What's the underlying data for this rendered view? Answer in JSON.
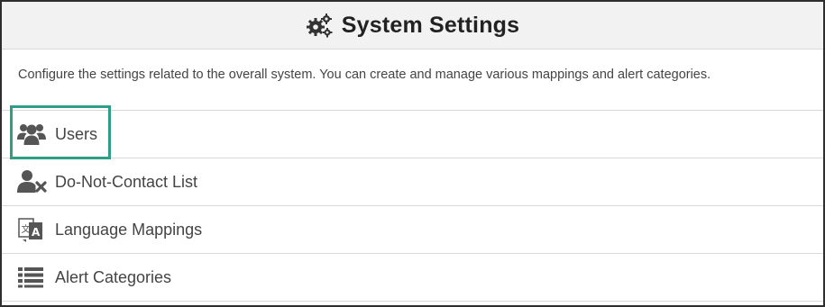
{
  "header": {
    "title": "System Settings",
    "icon": "gears-icon"
  },
  "description": "Configure the settings related to the overall system. You can create and manage various mappings and alert categories.",
  "menu": {
    "items": [
      {
        "label": "Users",
        "icon": "users-icon",
        "highlighted": true
      },
      {
        "label": "Do-Not-Contact List",
        "icon": "user-times-icon",
        "highlighted": false
      },
      {
        "label": "Language Mappings",
        "icon": "language-icon",
        "highlighted": false
      },
      {
        "label": "Alert Categories",
        "icon": "list-icon",
        "highlighted": false
      }
    ]
  },
  "colors": {
    "header_bg": "#f2f2f2",
    "highlight": "#2e9e86",
    "icon": "#555555",
    "border": "#d9d9d9"
  }
}
